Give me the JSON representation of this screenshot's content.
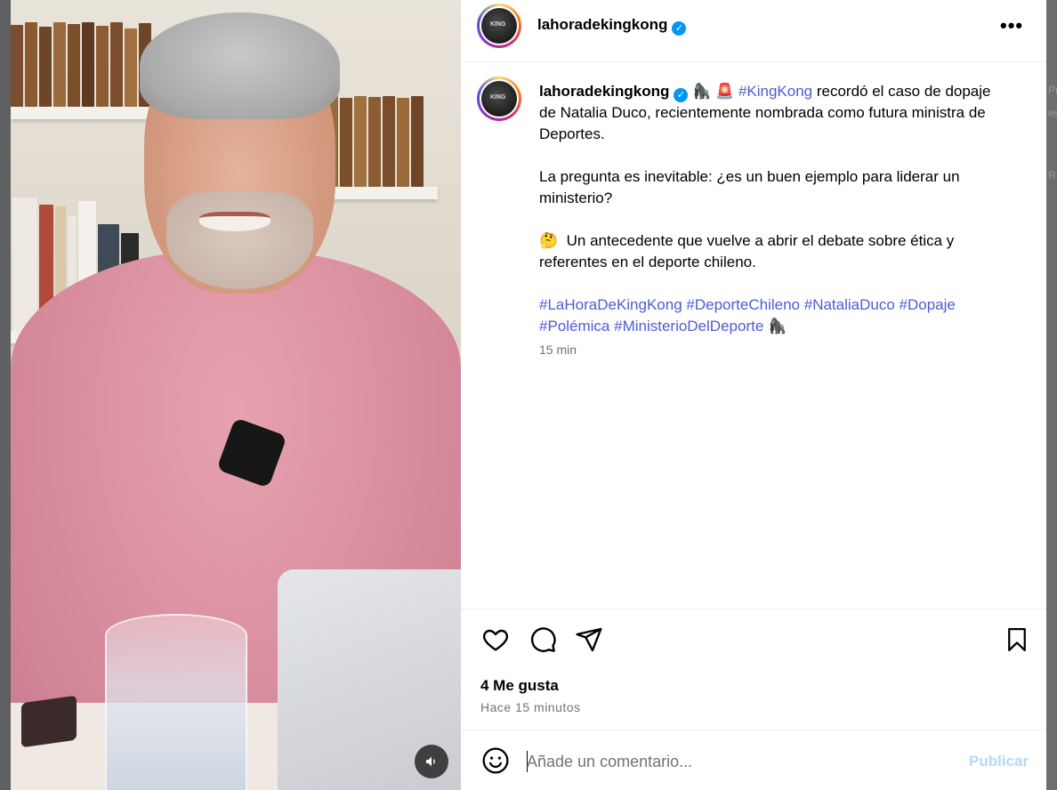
{
  "post": {
    "username": "lahoradekingkong",
    "verified_icon": "verified-badge-icon",
    "more_icon": "more-options-icon",
    "more_glyph": "•••"
  },
  "caption": {
    "username": "lahoradekingkong",
    "lead_emojis": "🦍 🚨",
    "hashtag_lead": "#KingKong",
    "line1_rest": " recordó el caso de dopaje de Natalia Duco, recientemente nombrada como futura ministra de Deportes.",
    "paragraph2": "La pregunta es inevitable: ¿es un buen ejemplo para liderar un ministerio?",
    "paragraph3_emoji": "🤔",
    "paragraph3": "Un antecedente que vuelve a abrir el debate sobre ética y referentes en el deporte chileno.",
    "hashtags": [
      "#LaHoraDeKingKong",
      "#DeporteChileno",
      "#NataliaDuco",
      "#Dopaje",
      "#Polémica",
      "#MinisterioDelDeporte"
    ],
    "trailing_emoji": "🦍",
    "time": "15 min"
  },
  "actions": {
    "like_icon": "heart-icon",
    "comment_icon": "comment-icon",
    "share_icon": "send-icon",
    "save_icon": "bookmark-icon",
    "likes": "4 Me gusta",
    "posted_ago": "Hace 15 minutos"
  },
  "comment": {
    "emoji_icon": "emoji-icon",
    "placeholder": "Añade un comentario...",
    "value": "",
    "publish_label": "Publicar"
  },
  "video": {
    "mute_icon": "speaker-icon",
    "mute_glyph": "🔊"
  },
  "background_page": {
    "peek_texts": [
      "Pr",
      "es",
      "R"
    ]
  },
  "colors": {
    "hashtag": "#4f5bd5",
    "verified": "#0095f6",
    "publish_disabled": "#b3d9fb",
    "secondary_text": "#737373"
  }
}
